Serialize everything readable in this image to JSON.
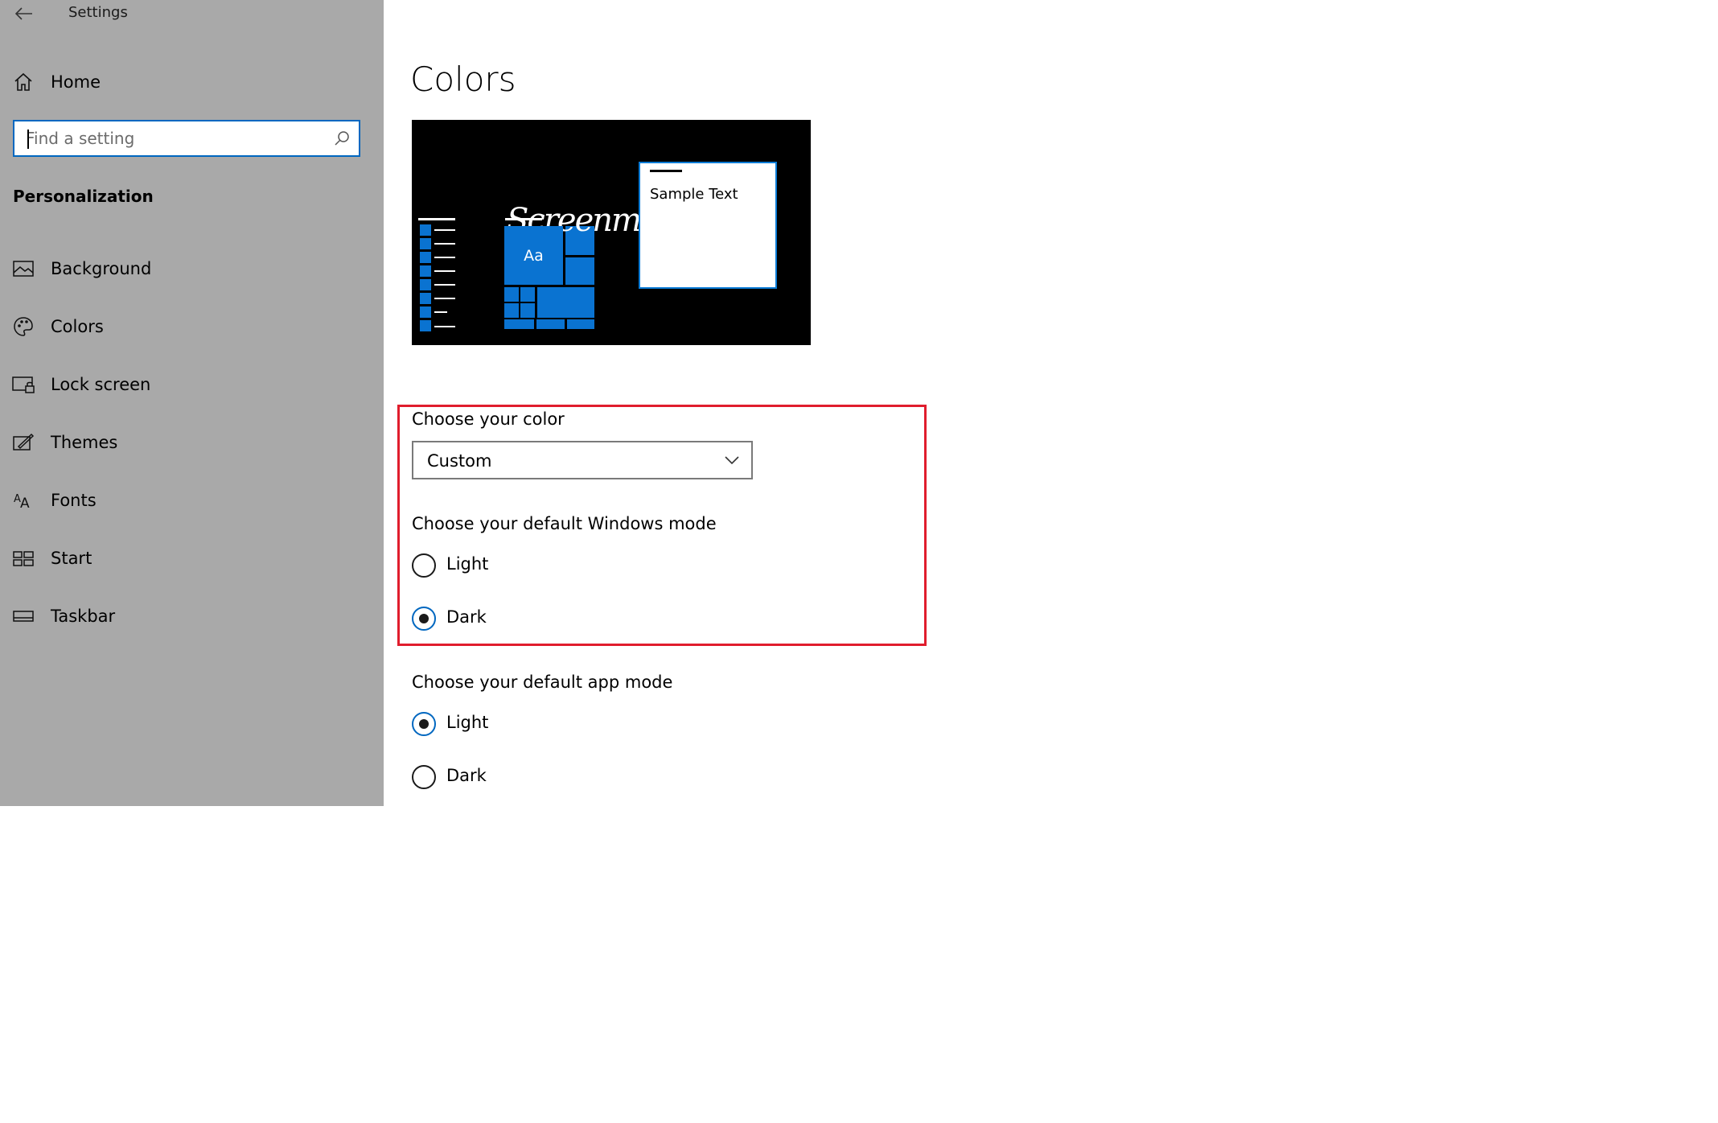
{
  "window": {
    "title": "Settings"
  },
  "sidebar": {
    "home_label": "Home",
    "search": {
      "placeholder": "Find a setting",
      "value": ""
    },
    "section": "Personalization",
    "items": [
      {
        "label": "Background",
        "icon": "picture-icon"
      },
      {
        "label": "Colors",
        "icon": "palette-icon"
      },
      {
        "label": "Lock screen",
        "icon": "lock-screen-icon"
      },
      {
        "label": "Themes",
        "icon": "themes-icon"
      },
      {
        "label": "Fonts",
        "icon": "fonts-icon"
      },
      {
        "label": "Start",
        "icon": "start-icon"
      },
      {
        "label": "Taskbar",
        "icon": "taskbar-icon"
      }
    ],
    "selected": "Colors"
  },
  "main": {
    "title": "Colors",
    "preview": {
      "tile_label": "Aa",
      "sample_text": "Sample Text",
      "script_text": "Screenmi"
    },
    "choose_color": {
      "label": "Choose your color",
      "value": "Custom"
    },
    "windows_mode": {
      "label": "Choose your default Windows mode",
      "options": [
        {
          "label": "Light",
          "checked": false
        },
        {
          "label": "Dark",
          "checked": true
        }
      ]
    },
    "app_mode": {
      "label": "Choose your default app mode",
      "options": [
        {
          "label": "Light",
          "checked": true
        },
        {
          "label": "Dark",
          "checked": false
        }
      ]
    }
  },
  "colors": {
    "sidebar_bg": "#a9a9a9",
    "accent": "#0078d7",
    "highlight": "#e01d2d",
    "preview_bg": "#000000"
  }
}
